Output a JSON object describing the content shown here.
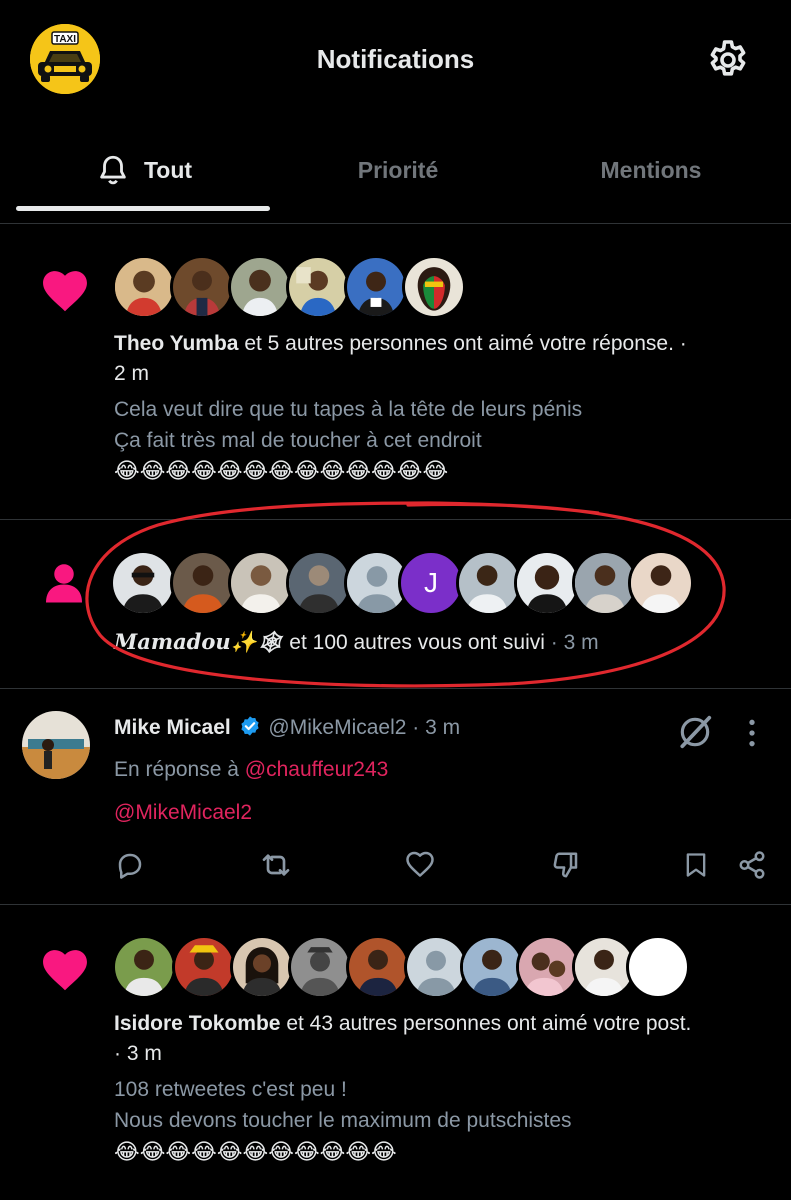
{
  "header": {
    "logo_text": "TAXI",
    "title": "Notifications",
    "settings_icon": "gear-icon"
  },
  "tabs": [
    {
      "label": "Tout",
      "icon": "bell-icon",
      "active": true
    },
    {
      "label": "Priorité",
      "active": false
    },
    {
      "label": "Mentions",
      "active": false
    }
  ],
  "notifications": [
    {
      "type": "like",
      "icon": "heart-icon",
      "actor": "Theo Yumba",
      "action_text": " et 5 autres personnes ont aimé votre réponse. ·",
      "time": "2 m",
      "content_lines": [
        "Cela veut dire que tu tapes à la tête de leurs pénis",
        "Ça fait très mal de toucher à cet endroit"
      ],
      "emoji": "😂😂😂😂😂😂😂😂😂😂😂😂😂"
    },
    {
      "type": "follow",
      "icon": "person-icon",
      "actor": "𝑴𝒂𝒎𝒂𝒅𝒐𝒖✨🕸",
      "action_text": " et 100 autres vous ont suivi",
      "time": "· 3 m",
      "initial_avatar": "J"
    },
    {
      "type": "reply",
      "author": "Mike Micael",
      "handle": "@MikeMicael2",
      "time": "· 3 m",
      "reply_prefix": "En réponse à ",
      "reply_to": "@chauffeur243",
      "body": "@MikeMicael2"
    },
    {
      "type": "like",
      "icon": "heart-icon",
      "actor": "Isidore Tokombe",
      "action_text": " et 43 autres personnes ont aimé votre post.",
      "time": "· 3 m",
      "content_lines": [
        "108 retweetes c'est peu !",
        "Nous devons toucher le maximum de putschistes"
      ],
      "emoji": "😂😂😂😂😂😂😂😂😂😂😂"
    }
  ],
  "colors": {
    "background": "#000000",
    "text": "#e7e9ea",
    "muted": "#8b98a5",
    "accent_pink": "#f91880",
    "link": "#e0245e",
    "verified": "#1d9bf0",
    "annotation": "#e0282e"
  }
}
